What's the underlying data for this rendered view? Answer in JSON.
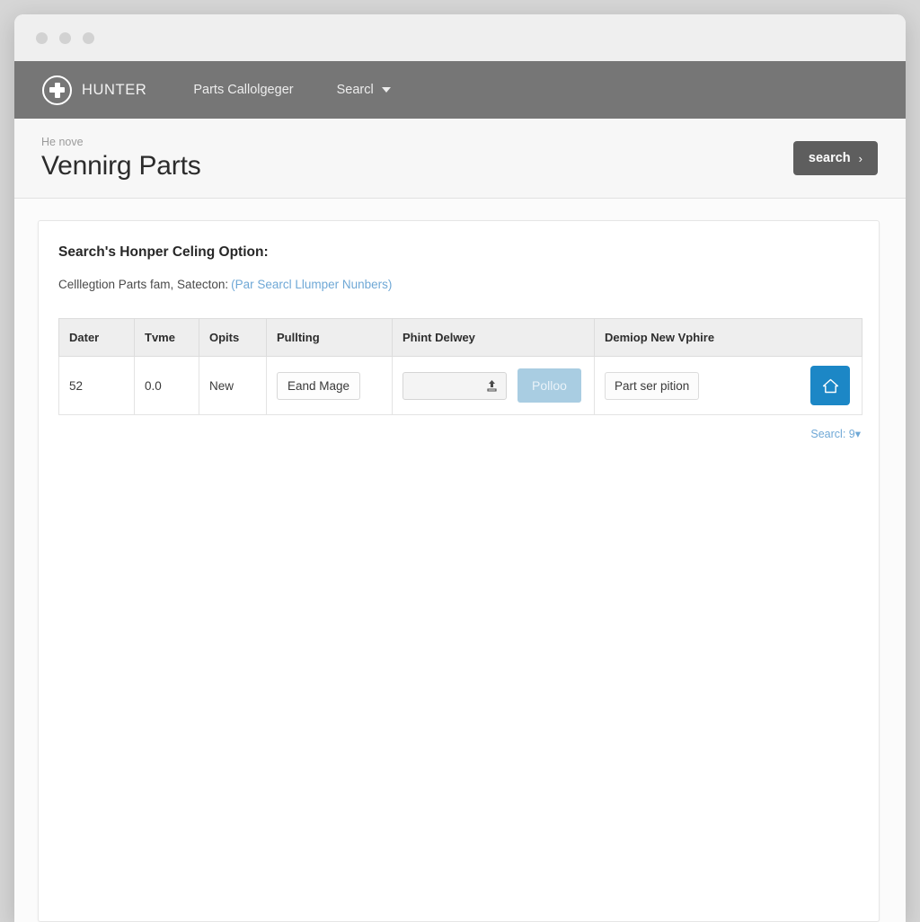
{
  "window": {
    "dots": [
      "close-dot",
      "minimize-dot",
      "maximize-dot"
    ]
  },
  "navbar": {
    "brand": "HUNTER",
    "links": [
      {
        "label": "Parts Callolgeger",
        "caret": false
      },
      {
        "label": "Searcl",
        "caret": true
      }
    ]
  },
  "page_header": {
    "breadcrumb": "He nove",
    "title": "Vennirg Parts",
    "search_button": "search",
    "search_button_chevron": "›"
  },
  "card": {
    "title": "Search's Honper Celing Option:",
    "subtitle": "Celllegtion Parts fam, Satecton:",
    "subtitle_link": "(Par Searcl Llumper Nunbers)"
  },
  "table": {
    "headers": [
      "Dater",
      "Tvme",
      "Opits",
      "Pullting",
      "Phint Delwey",
      "Demiop New Vphire"
    ],
    "rows": [
      {
        "dater": "52",
        "tvme": "0.0",
        "opits": "New",
        "pullting_button": "Eand Mage",
        "phint_file_value": "",
        "phint_action_button": "Polloo",
        "demiop_text": "Part ser pition"
      }
    ]
  },
  "table_footer": {
    "link": "Searcl: 9▾"
  },
  "colors": {
    "navbar_bg": "#767676",
    "accent_blue": "#1c87c6",
    "muted_blue": "#a9cde2",
    "link_blue": "#6fa8d6",
    "search_button_bg": "#5e5e5e"
  }
}
